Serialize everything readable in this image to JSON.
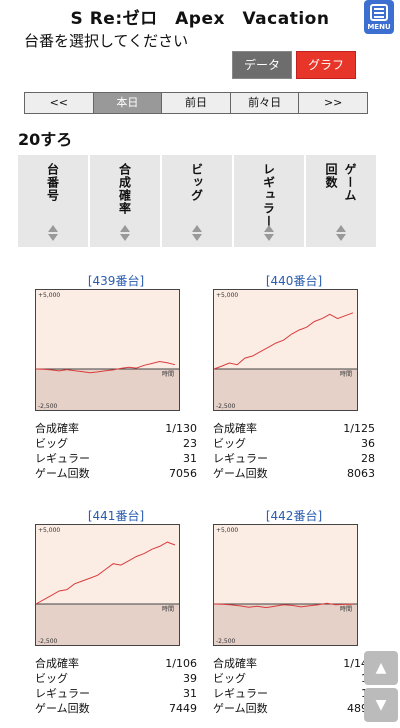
{
  "header": {
    "title": "S Re:ゼロ　Apex　Vacation",
    "subtitle": "台番を選択してください",
    "menu_label": "MENU"
  },
  "buttons": {
    "data": "データ",
    "graph": "グラフ"
  },
  "datebar": [
    "<<",
    "本日",
    "前日",
    "前々日",
    ">>"
  ],
  "section": {
    "title": "20すろ"
  },
  "columns": [
    "台番号",
    "合成確率",
    "ビッグ",
    "レギュラー",
    "ゲーム|回数"
  ],
  "graph_axis": {
    "top": "+5,000",
    "bottom": "-2,500",
    "time": "時間"
  },
  "stat_labels": {
    "combined": "合成確率",
    "big": "ビッグ",
    "regular": "レギュラー",
    "games": "ゲーム回数"
  },
  "cards": [
    {
      "title": "[439番台]",
      "combined": "1/130",
      "big": "23",
      "regular": "31",
      "games": "7056",
      "line": [
        0,
        -20,
        -60,
        -130,
        -40,
        -120,
        -180,
        -260,
        -200,
        -120,
        -60,
        40,
        120,
        60,
        260,
        380,
        520,
        430,
        300
      ]
    },
    {
      "title": "[440番台]",
      "combined": "1/125",
      "big": "36",
      "regular": "28",
      "games": "8063",
      "line": [
        0,
        200,
        420,
        300,
        760,
        900,
        1200,
        1500,
        1800,
        2000,
        2400,
        2700,
        2900,
        3300,
        3500,
        3800,
        3500,
        3700,
        3900
      ]
    },
    {
      "title": "[441番台]",
      "combined": "1/106",
      "big": "39",
      "regular": "31",
      "games": "7449",
      "line": [
        0,
        300,
        600,
        900,
        1000,
        1400,
        1600,
        1800,
        2000,
        2400,
        2800,
        2700,
        3000,
        3300,
        3500,
        3800,
        4000,
        4300,
        4100
      ]
    },
    {
      "title": "[442番台]",
      "combined": "1/148",
      "big": "16",
      "regular": "17",
      "games": "4892",
      "line": [
        0,
        -20,
        -60,
        -130,
        -220,
        -150,
        -250,
        -150,
        -50,
        -100,
        -200,
        -120,
        -50,
        50,
        -50,
        -30,
        -20
      ]
    }
  ],
  "scroll": {
    "up": "▲",
    "down": "▼"
  },
  "colors": {
    "graph_bg_upper": "#fbece4",
    "graph_bg_lower": "#e5d1c8",
    "line": "#d93d3d",
    "accent_red": "#e8352a",
    "link_blue": "#2a5db0"
  }
}
